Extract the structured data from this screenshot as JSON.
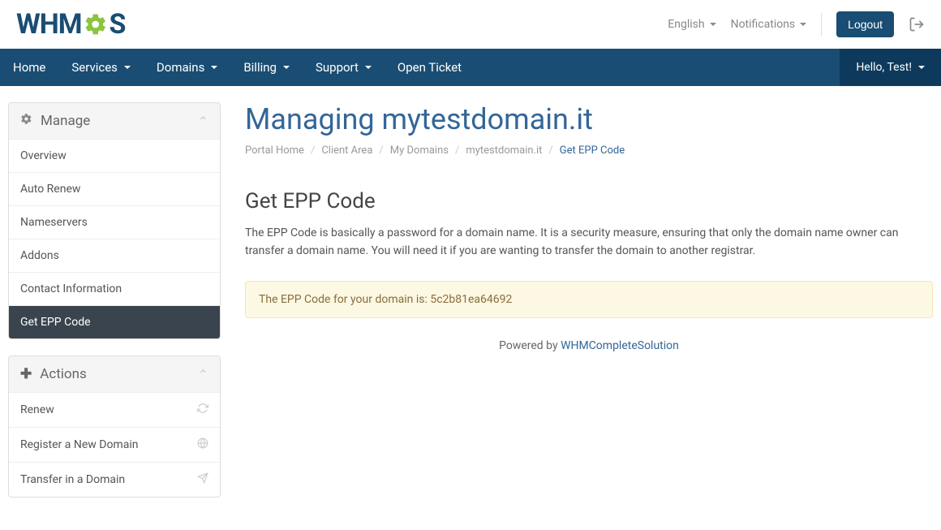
{
  "header": {
    "lang": "English",
    "notifications": "Notifications",
    "logout": "Logout"
  },
  "nav": {
    "items": [
      {
        "label": "Home",
        "dropdown": false
      },
      {
        "label": "Services",
        "dropdown": true
      },
      {
        "label": "Domains",
        "dropdown": true
      },
      {
        "label": "Billing",
        "dropdown": true
      },
      {
        "label": "Support",
        "dropdown": true
      },
      {
        "label": "Open Ticket",
        "dropdown": false
      }
    ],
    "greeting": "Hello, Test!"
  },
  "sidebar": {
    "manage": {
      "title": "Manage",
      "items": [
        {
          "label": "Overview",
          "active": false
        },
        {
          "label": "Auto Renew",
          "active": false
        },
        {
          "label": "Nameservers",
          "active": false
        },
        {
          "label": "Addons",
          "active": false
        },
        {
          "label": "Contact Information",
          "active": false
        },
        {
          "label": "Get EPP Code",
          "active": true
        }
      ]
    },
    "actions": {
      "title": "Actions",
      "items": [
        {
          "label": "Renew",
          "icon": "refresh"
        },
        {
          "label": "Register a New Domain",
          "icon": "globe"
        },
        {
          "label": "Transfer in a Domain",
          "icon": "share"
        }
      ]
    }
  },
  "page": {
    "title": "Managing mytestdomain.it",
    "breadcrumb": [
      "Portal Home",
      "Client Area",
      "My Domains",
      "mytestdomain.it",
      "Get EPP Code"
    ],
    "section_title": "Get EPP Code",
    "section_text": "The EPP Code is basically a password for a domain name. It is a security measure, ensuring that only the domain name owner can transfer a domain name. You will need it if you are wanting to transfer the domain to another registrar.",
    "alert_prefix": "The EPP Code for your domain is: ",
    "epp_code": "5c2b81ea64692",
    "footer_prefix": "Powered by ",
    "footer_link": "WHMCompleteSolution"
  }
}
